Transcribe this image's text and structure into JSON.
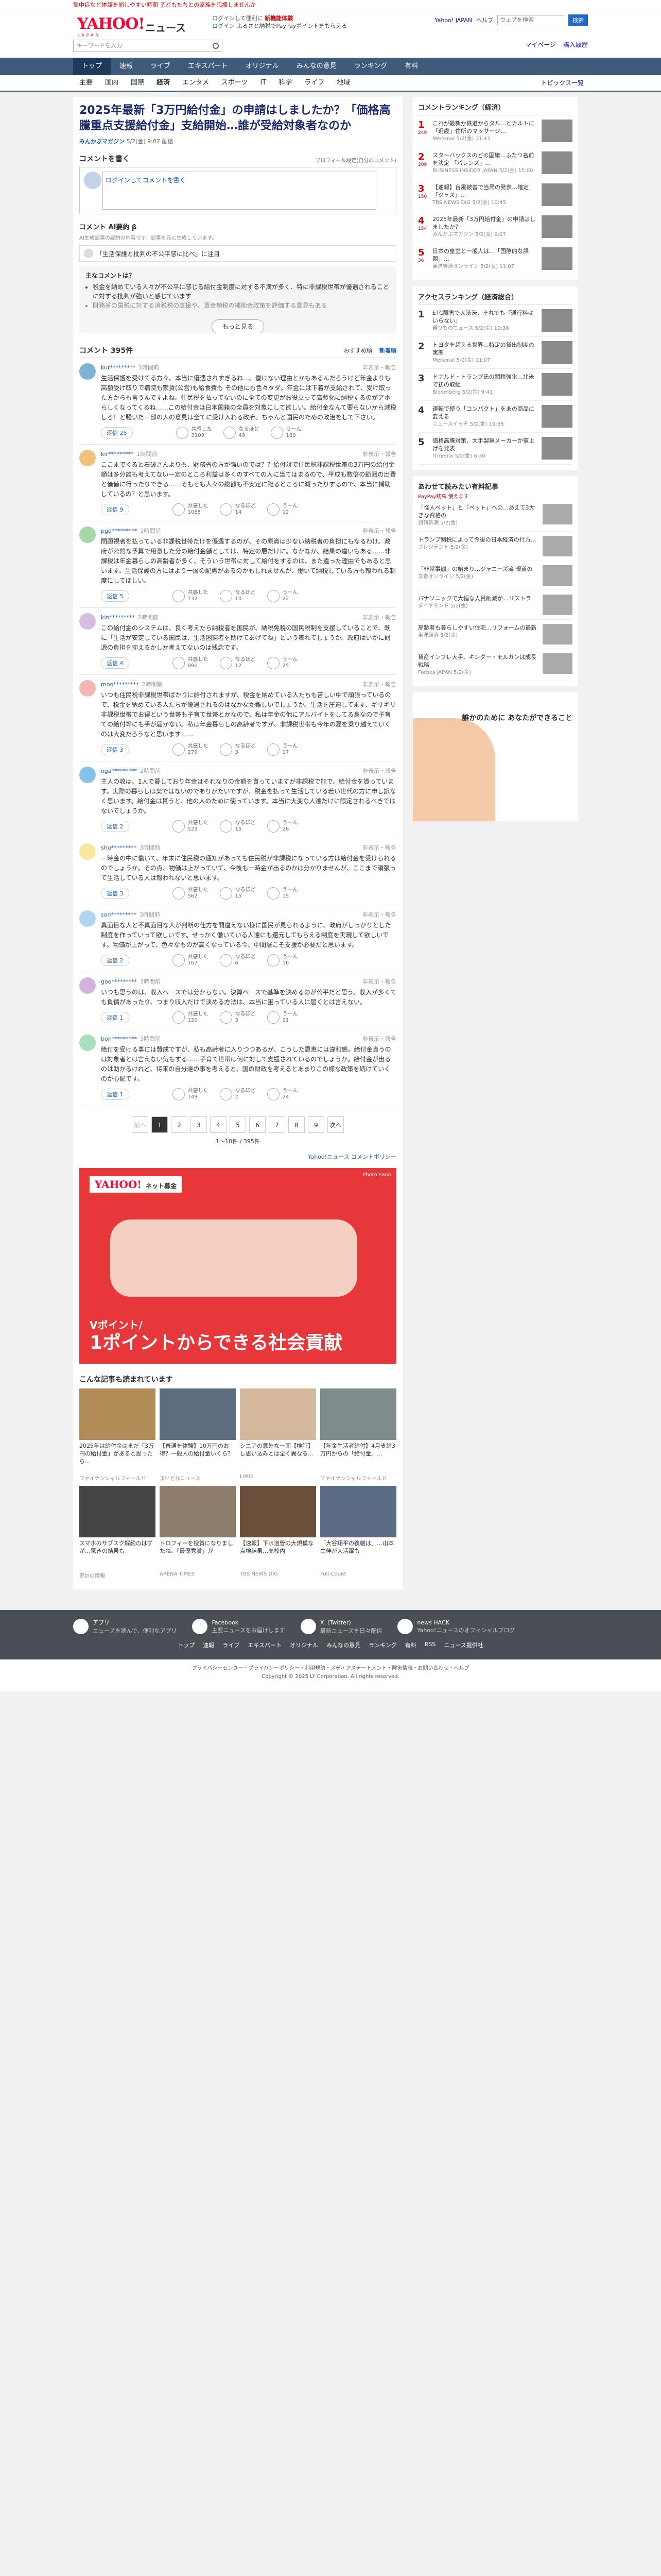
{
  "announce": "熱中症など体調を崩しやすい時期 子どもたちとの家族を応援しませんか",
  "header": {
    "logo": "YAHOO!",
    "logo_sub": "JAPAN",
    "section": "ニュース",
    "promo1": "ログインして便利に",
    "promo1b": "新機能体験",
    "promo2": "ログイン",
    "promo2b": "ふるさと納税でPayPayポイントをもらえる",
    "links": [
      "Yahoo! JAPAN",
      "ヘルプ"
    ],
    "search_placeholder": "ウェブを検索",
    "search_btn": "検索",
    "news_search": "キーワードを入力",
    "acct": [
      "マイページ",
      "購入履歴"
    ]
  },
  "nav": [
    "トップ",
    "速報",
    "ライブ",
    "エキスパート",
    "オリジナル",
    "みんなの意見",
    "ランキング",
    "有料"
  ],
  "nav2": [
    "主要",
    "国内",
    "国際",
    "経済",
    "エンタメ",
    "スポーツ",
    "IT",
    "科学",
    "ライフ",
    "地域"
  ],
  "nav2_on": 3,
  "topics": "トピックス一覧",
  "article": {
    "title": "2025年最新「3万円給付金」の申請はしましたか？「価格高騰重点支援給付金」支給開始…誰が受給対象者なのか",
    "source": "みんかぶマガジン",
    "date": "5/2(金) 9:07 配信"
  },
  "comment_form": {
    "heading": "コメントを書く",
    "guide": "プロフィール設定(自分のコメント)",
    "placeholder": "ログインしてコメントを書く"
  },
  "expert": {
    "heading": "コメント AI要約 β",
    "note": "AI生成記事の要約の内容です。記事を元に生成しています。",
    "question": "「生活保護と批判の不公平感に比べ」に注目",
    "points_title": "主なコメントは？",
    "points": [
      "税金を納めている人々が不公平に感じる給付金制度に対する不満が多く、特に非課税世帯が優遇されることに対する批判が強いと感じています",
      "財務省の国税に対する消税税の支援や、賃金増税の補助金政策を評価する意見もある"
    ],
    "more": "もっと見る"
  },
  "comments_head": {
    "title": "コメント 395件",
    "sort1": "おすすめ順",
    "sort2": "新着順"
  },
  "comments": [
    {
      "user": "kur*********",
      "time": "1時間前",
      "text": "生活保護を受けてる方々、本当に優遇されすぎるね…。働けない理由とかもあるんだろうけど年金よりも高額受け取りで病院も家賃(公営)も給食費も その他にも色々タダ。年金には下着が支給されて、受け取った方からも言うんですよね。住民税を払ってないのに全ての変更がお役立って高齢化に納税するのがアホらしくなってくるね……この給付金は日本国籍の全員を対象にして欲しい。給付金なんて要らないから減税しろ！と騒いだ一部の人の意見は全てに受け入れる政府。ちゃんと国民のための政治をして下さい。",
      "reply": "返信 25",
      "r": [
        "共感した",
        "3109",
        "なるほど",
        "49",
        "うーん",
        "160"
      ],
      "color": "#7fb3d5"
    },
    {
      "user": "kir*********",
      "time": "1時間前",
      "text": "ここまでくると石破さんよりも、財務省の方が強いのでは？？給付対で住民税非課税世帯の3万円の給付金額は多分誰も考えてない一定のところ利益は多くのすべての人に当てはまるので、平成も数倍の範囲の出費と価値に行ったりできる……そもそも人々の総額も不安定に陥るところに減ったりするので、本当に補助しているの？と思います。",
      "reply": "返信 9",
      "r": [
        "共感した",
        "1085",
        "なるほど",
        "14",
        "うーん",
        "12"
      ],
      "color": "#f0c27b"
    },
    {
      "user": "pgd*********",
      "time": "1時間前",
      "text": "問題視者を払っている非課税世帯だけを優遇するのが、その原資は少ない納税者の負担にもなるわけ。政府が公的な予算で用意した分の給付金額としては、特定の層だけに。なかなか、結果の違いもある……非課税は年金暮らしの高齢者が多く、そういう世帯に対して給付をするのは、また違った理由でもあると思います。生活保護の方にはより一層の配慮があるのかもしれませんが、働いて納税している方も報われる制度にしてほしい。",
      "reply": "返信 5",
      "r": [
        "共感した",
        "732",
        "なるほど",
        "10",
        "うーん",
        "22"
      ],
      "color": "#a3d9a5"
    },
    {
      "user": "kin*********",
      "time": "2時間前",
      "text": "この給付金のシステムは、良く考えたら納税者を国民が、納税免税の国民税制を支援していることで、既に「生活が安定している国民は、生活困窮者を助けてあげてね」という表れてしょうか。政府はいかに財源の負担を抑えるかしか考えてないのは残念です。",
      "reply": "返信 4",
      "r": [
        "共感した",
        "890",
        "なるほど",
        "12",
        "うーん",
        "25"
      ],
      "color": "#d7bde2"
    },
    {
      "user": "moo*********",
      "time": "2時間前",
      "text": "いつも住民税非課税世帯ばかりに給付されますが、税金を納めている人たちも苦しい中で頑張っているので、税金を納めている人たちが優遇されるのはなかなか難しいでしょうか。生活を圧迫してます、ギリギリ非課税世帯でお得という世帯も子育て世帯とかなので、私は年金の他にアルバイトをしてる身なので子育ての給付等にも手が届かない。私は年金暮らしの高齢者ですが、非課税世帯も今年の夏を乗り越えていくのは大変だろうなと思います……",
      "reply": "返信 3",
      "r": [
        "共感した",
        "279",
        "なるほど",
        "3",
        "うーん",
        "17"
      ],
      "color": "#f5b7b1"
    },
    {
      "user": "oga*********",
      "time": "2時間前",
      "text": "主人の收は、1人で暮しており年金はそれなりの金額を貰っていますが非課税で能で、給付金を貰っています。実際の暮らしは楽ではないのでありがたいですが、税金を払って生活している若い世代の方に申し訳なく思います。給付金は貰うと、他の人のために使っています。本当に大変な人達だけに限定されるべきではないでしょうか。",
      "reply": "返信 2",
      "r": [
        "共感した",
        "523",
        "なるほど",
        "15",
        "うーん",
        "26"
      ],
      "color": "#85c1e9"
    },
    {
      "user": "shu*********",
      "time": "3時間前",
      "text": "一時金の中に働いて、年末に住民税の通知があっても住民税が非課税になっている方は給付金を受けられるのでしょうか。その点、物価は上がっていて、今後も一時金が出るのかは分かりませんが、ここまで頑張って生活している人は報われないと思います。",
      "reply": "返信 3",
      "r": [
        "共感した",
        "562",
        "なるほど",
        "15",
        "うーん",
        "15"
      ],
      "color": "#f9e79f"
    },
    {
      "user": "son*********",
      "time": "3時間前",
      "text": "真面目な人と不真面目な人が判断の仕方を間違えない様に国民が見られるように、政府がしっかりとした制度を作っていって欲しいです。せっかく働いている人達にも還元してもらえる制度を実現して欲しいです。物価が上がって、色々なものが高くなっている今、中間層こそ支援が必要だと思います。",
      "reply": "返信 2",
      "r": [
        "共感した",
        "167",
        "なるほど",
        "6",
        "うーん",
        "16"
      ],
      "color": "#aed6f1"
    },
    {
      "user": "goo*********",
      "time": "3時間前",
      "text": "いつも思うのは、収入ベースでは分からない。決算ベースで基準を決めるのが公平だと思う。収入が多くても負債があったり、つまり収入だけで決める方法は、本当に困っている人に届くとは言えない。",
      "reply": "返信 1",
      "r": [
        "共感した",
        "120",
        "なるほど",
        "3",
        "うーん",
        "21"
      ],
      "color": "#d2b4de"
    },
    {
      "user": "bon*********",
      "time": "3時間前",
      "text": "給付を受ける事には賛成ですが、私も高齢者に入りつつあるが、こうした恩恵には違和感。給付金貰うのは対象者とは言えない気もする……子育て世帯は何に対して支援されているのでしょうか。給付金が出るのは助かるけれど、将来の自分達の事を考えると、国の財政を考えるとあまりこの様な政策を続けていくのが心配です。",
      "reply": "返信 1",
      "r": [
        "共感した",
        "149",
        "なるほど",
        "2",
        "うーん",
        "24"
      ],
      "color": "#a9dfbf"
    }
  ],
  "pager": {
    "prev": "前へ",
    "pages": [
      "1",
      "2",
      "3",
      "4",
      "5",
      "6",
      "7",
      "8",
      "9"
    ],
    "next": "次へ",
    "count": "1〜10件 / 395件"
  },
  "commenter_link": "Yahoo!ニュース コメントポリシー",
  "ad": {
    "logo": "YAHOO!",
    "logo_sub": "ネット募金",
    "pr": "Photo:sano",
    "line1": "Vポイント/",
    "line2": "1ポイントからできる社会貢献"
  },
  "rec_heading": "こんな記事も読まれています",
  "rec": [
    {
      "t": "2025年は給付金はまだ「3万円の給付金」があると思ったら…",
      "s": "ファイナンシャルフィールド"
    },
    {
      "t": "【普通を体験】10万円のお得？一般人の給付金いくら？",
      "s": "まいどなニュース"
    },
    {
      "t": "シニアの意外な一面【検証】し思い込みとは全く異なる…",
      "s": "LIMO"
    },
    {
      "t": "【年金生活者給付】4月支給3万円からの「給付金」…",
      "s": "ファイナンシャルフィールド"
    },
    {
      "t": "スマホのサブスク解約のはずが…驚きの結果も",
      "s": "家計の情報"
    },
    {
      "t": "トロフィーを授賞になりましたね。「最優秀賞」が",
      "s": "ARENA TIMES"
    },
    {
      "t": "【速報】下水道管の大規模な点検結果…高校内",
      "s": "TBS NEWS DIG"
    },
    {
      "t": "「大谷翔平の後継は」…山本由伸が大活躍も",
      "s": "Full-Count"
    }
  ],
  "side": {
    "rank_heading": "コメントランキング（経済）",
    "ranks": [
      {
        "n": "1",
        "c": "249",
        "t": "これが最新か鉄道からタル…とカルトに「近畿」住所のマッサージ…",
        "s": "Merkmal 5/2(金) 11:43"
      },
      {
        "n": "2",
        "c": "209",
        "t": "スターバックスのどの国旗…ふたつ名前を決定 「パレンズ」…",
        "s": "BUSINESS INSIDER JAPAN 5/2(金) 15:00"
      },
      {
        "n": "3",
        "c": "150",
        "t": "【速報】台風被害で当局の発表…確定「ジャス」…",
        "s": "TBS NEWS DIG 5/2(金) 10:45"
      },
      {
        "n": "4",
        "c": "154",
        "t": "2025年最新「3万円給付金」の申請はしましたか？",
        "s": "みんかぶマガジン 5/2(金) 9:07"
      },
      {
        "n": "5",
        "c": "36",
        "t": "日本の皇室と一般人は…「国際的な課題」…",
        "s": "東洋経済オンライン 5/2(金) 11:07"
      }
    ],
    "access_heading": "アクセスランキング（経済総合）",
    "access": [
      {
        "t": "ETC障害で大渋滞、それでも「通行料はいらない」",
        "s": "乗りものニュース 5/2(金) 10:38"
      },
      {
        "t": "トヨタを超える世界…特定の貸出制度の実態",
        "s": "Merkmal 5/2(金) 11:07"
      },
      {
        "t": "ドナルド・トランプ氏の関税強化…北米で初の取組",
        "s": "Bloomberg 5/2(金) 9:41"
      },
      {
        "t": "運転で使う「コンパクト」をあの商品に変える",
        "s": "ニュースイッチ 5/2(金) 19:38"
      },
      {
        "t": "価格高騰対策、大手製菓メーカーが値上げを発表",
        "s": "ITmedia 5/2(金) 6:30"
      }
    ],
    "pp_heading": "あわせて読みたい有料記事",
    "pp_sub": "PayPay残高 使えます",
    "pp": [
      {
        "t": "「怪人ペット」と「ペット」への…あえて3大きな資格の",
        "s": "週刊新潮 5/2(金)"
      },
      {
        "t": "トランプ関税によって今後の日本経済の行方…",
        "s": "プレジデント 5/2(金)"
      },
      {
        "t": "「非常事態」の始まり…ジャニーズ流 報道の",
        "s": "文春オンライン 5/2(金)"
      },
      {
        "t": "パナソニックで大幅な人員削減が…リストラ",
        "s": "ダイヤモンド 5/2(金)"
      },
      {
        "t": "高齢者も暮らしやすい住宅…リフォームの最新",
        "s": "東洋経済 5/2(金)"
      },
      {
        "t": "資産インフレ大手、キンダー・モルガンは成長戦略",
        "s": "Forbes JAPAN 5/2(金)"
      }
    ],
    "side_ad": "誰かのために あなたができること"
  },
  "footer": {
    "items": [
      {
        "h": "アプリ",
        "t": "ニュースを読んで、便利なアプリ"
      },
      {
        "h": "Facebook",
        "t": "主要ニュースをお届けします"
      },
      {
        "h": "X（Twitter）",
        "t": "最新ニュースを日々配信"
      },
      {
        "h": "news HACK",
        "t": "Yahoo!ニュースのオフィシャルブログ"
      }
    ],
    "links": [
      "トップ",
      "速報",
      "ライブ",
      "エキスパート",
      "オリジナル",
      "みんなの意見",
      "ランキング",
      "有料",
      "RSS",
      "ニュース提供社"
    ],
    "legal": "プライバシーセンター・プライバシーポリシー・利用規約・メディアステートメント・障害情報・お問い合わせ・ヘルプ",
    "copy": "Copyright © 2025 LY Corporation. All rights reserved."
  }
}
